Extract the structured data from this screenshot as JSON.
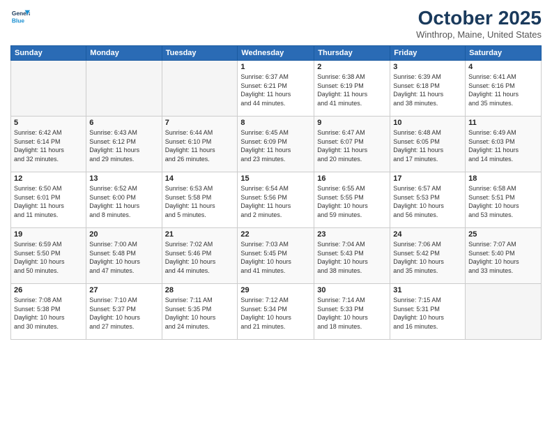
{
  "header": {
    "logo_line1": "General",
    "logo_line2": "Blue",
    "month": "October 2025",
    "location": "Winthrop, Maine, United States"
  },
  "weekdays": [
    "Sunday",
    "Monday",
    "Tuesday",
    "Wednesday",
    "Thursday",
    "Friday",
    "Saturday"
  ],
  "weeks": [
    [
      {
        "day": "",
        "info": ""
      },
      {
        "day": "",
        "info": ""
      },
      {
        "day": "",
        "info": ""
      },
      {
        "day": "1",
        "info": "Sunrise: 6:37 AM\nSunset: 6:21 PM\nDaylight: 11 hours\nand 44 minutes."
      },
      {
        "day": "2",
        "info": "Sunrise: 6:38 AM\nSunset: 6:19 PM\nDaylight: 11 hours\nand 41 minutes."
      },
      {
        "day": "3",
        "info": "Sunrise: 6:39 AM\nSunset: 6:18 PM\nDaylight: 11 hours\nand 38 minutes."
      },
      {
        "day": "4",
        "info": "Sunrise: 6:41 AM\nSunset: 6:16 PM\nDaylight: 11 hours\nand 35 minutes."
      }
    ],
    [
      {
        "day": "5",
        "info": "Sunrise: 6:42 AM\nSunset: 6:14 PM\nDaylight: 11 hours\nand 32 minutes."
      },
      {
        "day": "6",
        "info": "Sunrise: 6:43 AM\nSunset: 6:12 PM\nDaylight: 11 hours\nand 29 minutes."
      },
      {
        "day": "7",
        "info": "Sunrise: 6:44 AM\nSunset: 6:10 PM\nDaylight: 11 hours\nand 26 minutes."
      },
      {
        "day": "8",
        "info": "Sunrise: 6:45 AM\nSunset: 6:09 PM\nDaylight: 11 hours\nand 23 minutes."
      },
      {
        "day": "9",
        "info": "Sunrise: 6:47 AM\nSunset: 6:07 PM\nDaylight: 11 hours\nand 20 minutes."
      },
      {
        "day": "10",
        "info": "Sunrise: 6:48 AM\nSunset: 6:05 PM\nDaylight: 11 hours\nand 17 minutes."
      },
      {
        "day": "11",
        "info": "Sunrise: 6:49 AM\nSunset: 6:03 PM\nDaylight: 11 hours\nand 14 minutes."
      }
    ],
    [
      {
        "day": "12",
        "info": "Sunrise: 6:50 AM\nSunset: 6:01 PM\nDaylight: 11 hours\nand 11 minutes."
      },
      {
        "day": "13",
        "info": "Sunrise: 6:52 AM\nSunset: 6:00 PM\nDaylight: 11 hours\nand 8 minutes."
      },
      {
        "day": "14",
        "info": "Sunrise: 6:53 AM\nSunset: 5:58 PM\nDaylight: 11 hours\nand 5 minutes."
      },
      {
        "day": "15",
        "info": "Sunrise: 6:54 AM\nSunset: 5:56 PM\nDaylight: 11 hours\nand 2 minutes."
      },
      {
        "day": "16",
        "info": "Sunrise: 6:55 AM\nSunset: 5:55 PM\nDaylight: 10 hours\nand 59 minutes."
      },
      {
        "day": "17",
        "info": "Sunrise: 6:57 AM\nSunset: 5:53 PM\nDaylight: 10 hours\nand 56 minutes."
      },
      {
        "day": "18",
        "info": "Sunrise: 6:58 AM\nSunset: 5:51 PM\nDaylight: 10 hours\nand 53 minutes."
      }
    ],
    [
      {
        "day": "19",
        "info": "Sunrise: 6:59 AM\nSunset: 5:50 PM\nDaylight: 10 hours\nand 50 minutes."
      },
      {
        "day": "20",
        "info": "Sunrise: 7:00 AM\nSunset: 5:48 PM\nDaylight: 10 hours\nand 47 minutes."
      },
      {
        "day": "21",
        "info": "Sunrise: 7:02 AM\nSunset: 5:46 PM\nDaylight: 10 hours\nand 44 minutes."
      },
      {
        "day": "22",
        "info": "Sunrise: 7:03 AM\nSunset: 5:45 PM\nDaylight: 10 hours\nand 41 minutes."
      },
      {
        "day": "23",
        "info": "Sunrise: 7:04 AM\nSunset: 5:43 PM\nDaylight: 10 hours\nand 38 minutes."
      },
      {
        "day": "24",
        "info": "Sunrise: 7:06 AM\nSunset: 5:42 PM\nDaylight: 10 hours\nand 35 minutes."
      },
      {
        "day": "25",
        "info": "Sunrise: 7:07 AM\nSunset: 5:40 PM\nDaylight: 10 hours\nand 33 minutes."
      }
    ],
    [
      {
        "day": "26",
        "info": "Sunrise: 7:08 AM\nSunset: 5:38 PM\nDaylight: 10 hours\nand 30 minutes."
      },
      {
        "day": "27",
        "info": "Sunrise: 7:10 AM\nSunset: 5:37 PM\nDaylight: 10 hours\nand 27 minutes."
      },
      {
        "day": "28",
        "info": "Sunrise: 7:11 AM\nSunset: 5:35 PM\nDaylight: 10 hours\nand 24 minutes."
      },
      {
        "day": "29",
        "info": "Sunrise: 7:12 AM\nSunset: 5:34 PM\nDaylight: 10 hours\nand 21 minutes."
      },
      {
        "day": "30",
        "info": "Sunrise: 7:14 AM\nSunset: 5:33 PM\nDaylight: 10 hours\nand 18 minutes."
      },
      {
        "day": "31",
        "info": "Sunrise: 7:15 AM\nSunset: 5:31 PM\nDaylight: 10 hours\nand 16 minutes."
      },
      {
        "day": "",
        "info": ""
      }
    ]
  ]
}
